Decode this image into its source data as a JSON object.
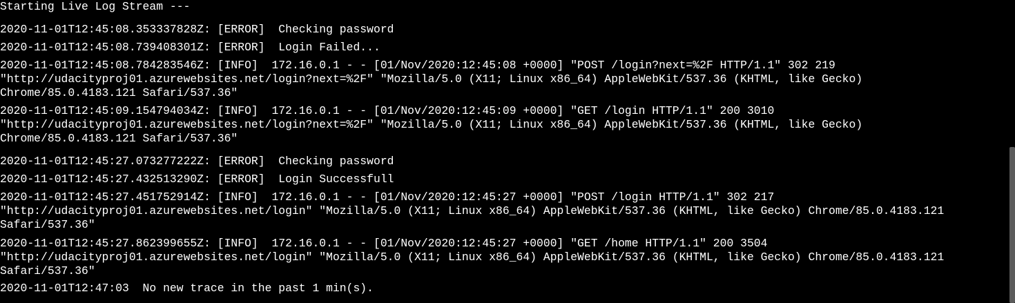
{
  "terminal": {
    "foreground": "#ffffff",
    "background": "#000000",
    "lines": [
      "Starting Live Log Stream ---",
      "2020-11-01T12:45:08.353337828Z: [ERROR]  Checking password",
      "2020-11-01T12:45:08.739408301Z: [ERROR]  Login Failed...",
      "2020-11-01T12:45:08.784283546Z: [INFO]  172.16.0.1 - - [01/Nov/2020:12:45:08 +0000] \"POST /login?next=%2F HTTP/1.1\" 302 219",
      "\"http://udacityproj01.azurewebsites.net/login?next=%2F\" \"Mozilla/5.0 (X11; Linux x86_64) AppleWebKit/537.36 (KHTML, like Gecko)",
      "Chrome/85.0.4183.121 Safari/537.36\"",
      "2020-11-01T12:45:09.154794034Z: [INFO]  172.16.0.1 - - [01/Nov/2020:12:45:09 +0000] \"GET /login HTTP/1.1\" 200 3010",
      "\"http://udacityproj01.azurewebsites.net/login?next=%2F\" \"Mozilla/5.0 (X11; Linux x86_64) AppleWebKit/537.36 (KHTML, like Gecko)",
      "Chrome/85.0.4183.121 Safari/537.36\"",
      "2020-11-01T12:45:27.073277222Z: [ERROR]  Checking password",
      "2020-11-01T12:45:27.432513290Z: [ERROR]  Login Successfull",
      "2020-11-01T12:45:27.451752914Z: [INFO]  172.16.0.1 - - [01/Nov/2020:12:45:27 +0000] \"POST /login HTTP/1.1\" 302 217",
      "\"http://udacityproj01.azurewebsites.net/login\" \"Mozilla/5.0 (X11; Linux x86_64) AppleWebKit/537.36 (KHTML, like Gecko) Chrome/85.0.4183.121",
      "Safari/537.36\"",
      "2020-11-01T12:45:27.862399655Z: [INFO]  172.16.0.1 - - [01/Nov/2020:12:45:27 +0000] \"GET /home HTTP/1.1\" 200 3504",
      "\"http://udacityproj01.azurewebsites.net/login\" \"Mozilla/5.0 (X11; Linux x86_64) AppleWebKit/537.36 (KHTML, like Gecko) Chrome/85.0.4183.121",
      "Safari/537.36\"",
      "2020-11-01T12:47:03  No new trace in the past 1 min(s)."
    ]
  }
}
